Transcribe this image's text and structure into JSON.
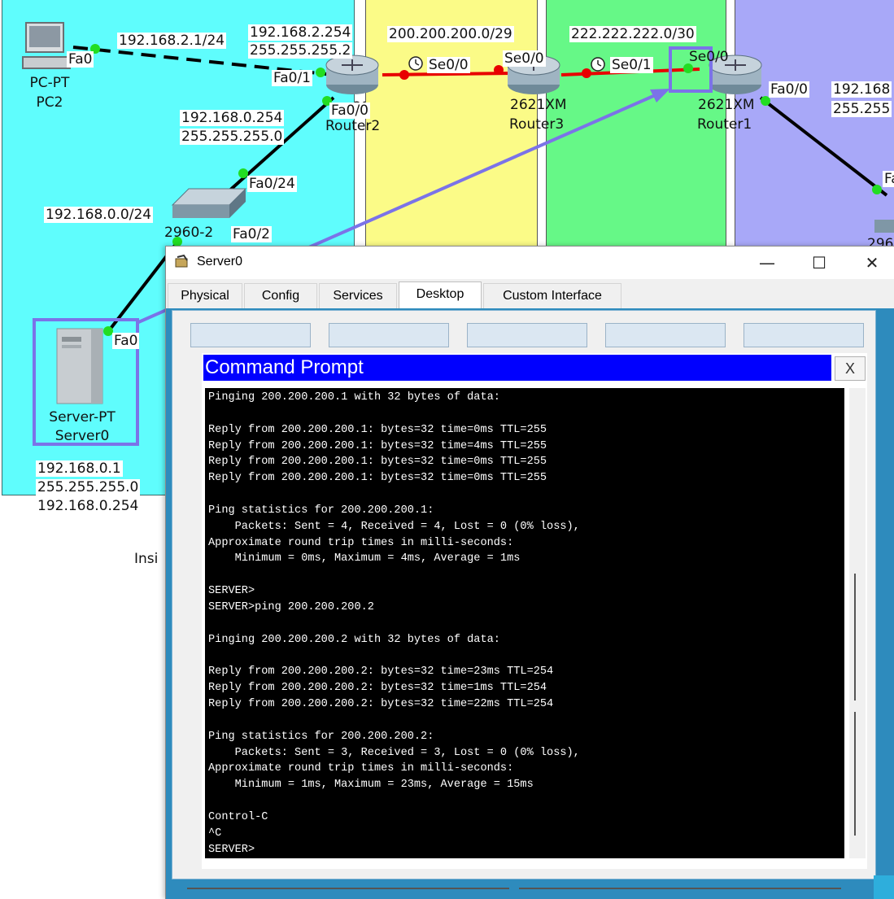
{
  "topology": {
    "zones": {
      "inside_color": "#5ffdfd",
      "zone2_color": "#fbfb87",
      "zone3_color": "#66f887",
      "zone4_color": "#a8a8f8"
    },
    "networks": {
      "pc_link": "192.168.2.1/24",
      "wan1": "200.200.200.0/29",
      "wan2": "222.222.222.0/30",
      "lan": "192.168.0.0/24"
    },
    "router2": {
      "model": "2621XM",
      "name": "Router2",
      "ip_fa01": "192.168.2.254",
      "mask_fa01": "255.255.255.2",
      "ip_fa00": "192.168.0.254",
      "mask_fa00": "255.255.255.0",
      "if_fa01": "Fa0/1",
      "if_fa00": "Fa0/0",
      "if_se00": "Se0/0"
    },
    "router3": {
      "model": "2621XM",
      "name": "Router3",
      "if_se00": "Se0/0",
      "if_se01": "Se0/1"
    },
    "router1": {
      "model": "2621XM",
      "name": "Router1",
      "if_se00": "Se0/0",
      "if_fa00": "Fa0/0",
      "ip_right": "192.168",
      "mask_right": "255.255"
    },
    "pc2": {
      "type": "PC-PT",
      "name": "PC2",
      "if": "Fa0"
    },
    "switch": {
      "name": "2960-2",
      "if_fa024": "Fa0/24",
      "if_fa02": "Fa0/2",
      "if_fa01": "Fa0/1"
    },
    "server0": {
      "type": "Server-PT",
      "name": "Server0",
      "if": "Fa0",
      "ip": "192.168.0.1",
      "mask": "255.255.255.0",
      "gateway": "192.168.0.254"
    },
    "right_partial_if": "Fa",
    "right_partial_device": "296",
    "inside_partial_label": "Insi",
    "highlight_color": "#7b73e8"
  },
  "window": {
    "title": "Server0",
    "minimize_glyph": "—",
    "maximize_glyph": "☐",
    "close_glyph": "✕",
    "tabs": [
      {
        "label": "Physical",
        "active": false
      },
      {
        "label": "Config",
        "active": false
      },
      {
        "label": "Services",
        "active": false
      },
      {
        "label": "Desktop",
        "active": true
      },
      {
        "label": "Custom Interface",
        "active": false
      }
    ]
  },
  "command_prompt": {
    "title": "Command Prompt",
    "close_label": "X",
    "output": "Pinging 200.200.200.1 with 32 bytes of data:\n\nReply from 200.200.200.1: bytes=32 time=0ms TTL=255\nReply from 200.200.200.1: bytes=32 time=4ms TTL=255\nReply from 200.200.200.1: bytes=32 time=0ms TTL=255\nReply from 200.200.200.1: bytes=32 time=0ms TTL=255\n\nPing statistics for 200.200.200.1:\n    Packets: Sent = 4, Received = 4, Lost = 0 (0% loss),\nApproximate round trip times in milli-seconds:\n    Minimum = 0ms, Maximum = 4ms, Average = 1ms\n\nSERVER>\nSERVER>ping 200.200.200.2\n\nPinging 200.200.200.2 with 32 bytes of data:\n\nReply from 200.200.200.2: bytes=32 time=23ms TTL=254\nReply from 200.200.200.2: bytes=32 time=1ms TTL=254\nReply from 200.200.200.2: bytes=32 time=22ms TTL=254\n\nPing statistics for 200.200.200.2:\n    Packets: Sent = 3, Received = 3, Lost = 0 (0% loss),\nApproximate round trip times in milli-seconds:\n    Minimum = 1ms, Maximum = 23ms, Average = 15ms\n\nControl-C\n^C\nSERVER>"
  }
}
